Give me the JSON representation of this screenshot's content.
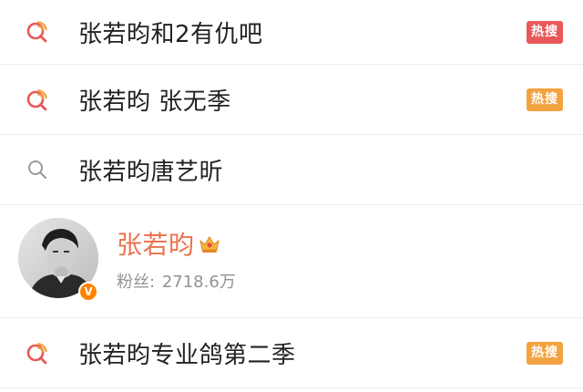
{
  "colors": {
    "hot_red": "#e8585a",
    "hot_orange": "#f2a340",
    "username_orange": "#eb7350",
    "text": "#222222",
    "subtext": "#939393",
    "divider": "#ececec"
  },
  "results": [
    {
      "label": "张若昀和2有仇吧",
      "badge": "热搜",
      "badge_color": "red",
      "icon": "hot-search-icon"
    },
    {
      "label": "张若昀 张无季",
      "badge": "热搜",
      "badge_color": "orange",
      "icon": "hot-search-icon"
    },
    {
      "label": "张若昀唐艺昕",
      "badge": null,
      "icon": "search-icon"
    }
  ],
  "user": {
    "name": "张若昀",
    "followers_label": "粉丝:",
    "followers_value": "2718.6万",
    "verified_icon": "verified-v-icon",
    "crown_icon": "crown-icon",
    "avatar": "user-avatar-photo"
  },
  "results_after": [
    {
      "label": "张若昀专业鸽第二季",
      "badge": "热搜",
      "badge_color": "orange",
      "icon": "hot-search-icon"
    }
  ]
}
